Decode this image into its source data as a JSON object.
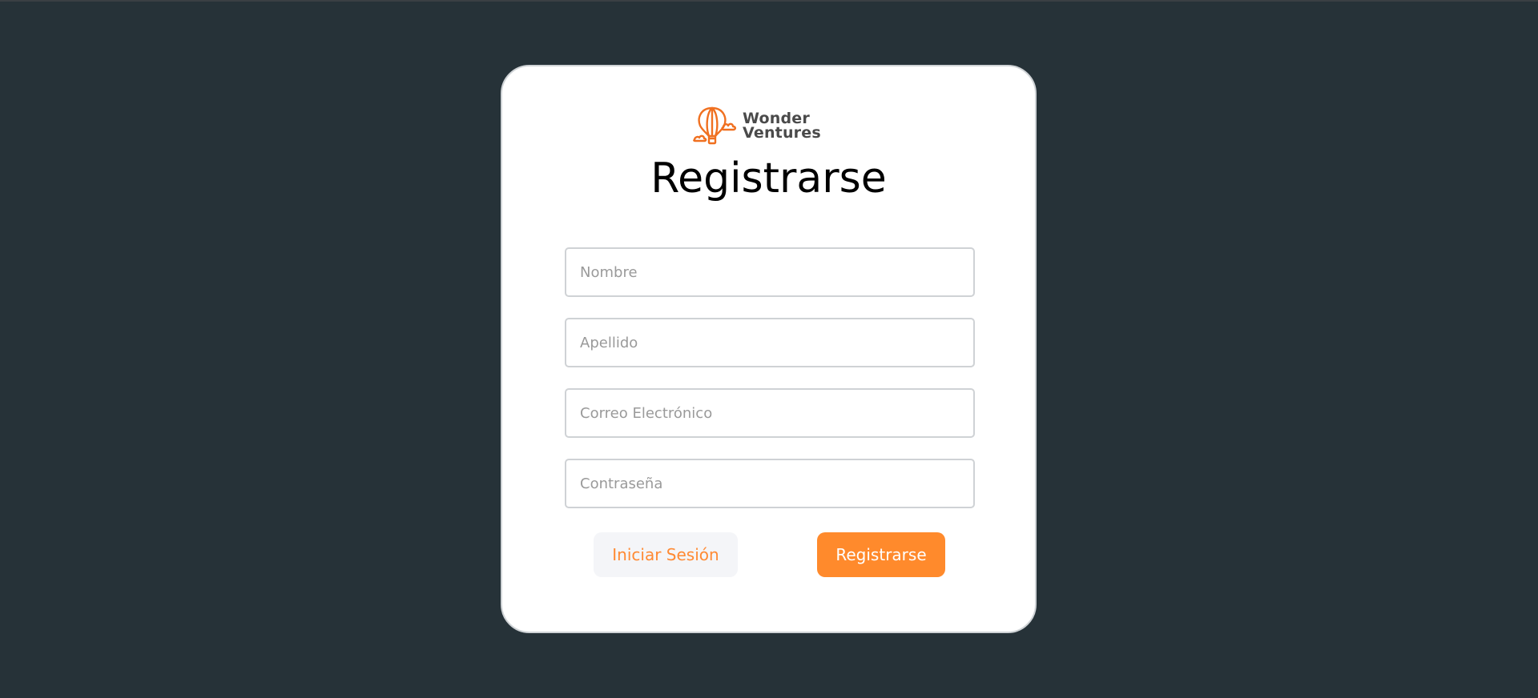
{
  "logo": {
    "line1": "Wonder",
    "line2": "Ventures",
    "icon": "hot-air-balloon-icon",
    "color": "#f07020"
  },
  "form": {
    "title": "Registrarse",
    "fields": [
      {
        "name": "nombre",
        "placeholder": "Nombre",
        "value": ""
      },
      {
        "name": "apellido",
        "placeholder": "Apellido",
        "value": ""
      },
      {
        "name": "correo",
        "placeholder": "Correo Electrónico",
        "value": ""
      },
      {
        "name": "contrasena",
        "placeholder": "Contraseña",
        "value": ""
      }
    ],
    "login_label": "Iniciar Sesión",
    "register_label": "Registrarse"
  },
  "colors": {
    "background": "#263238",
    "accent": "#ff8a2c",
    "card": "#ffffff"
  }
}
